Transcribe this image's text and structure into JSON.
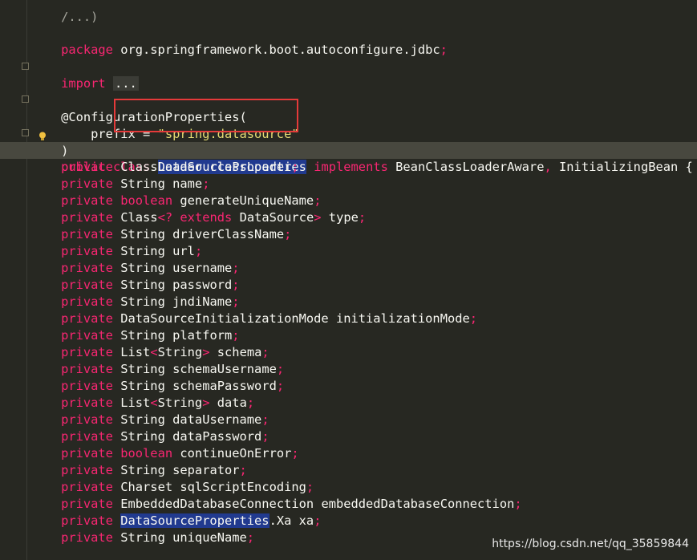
{
  "lines": {
    "top": "/...)",
    "package_kw": "package",
    "package_name": " org.springframework.boot.autoconfigure.jdbc",
    "package_end": ";",
    "import_kw": "import",
    "import_fold": "...",
    "annotation": "@ConfigurationProperties(",
    "prefix_name": "    prefix = ",
    "prefix_value": "\"spring.datasource\"",
    "close_paren": ")",
    "class_kw1": "public",
    "class_kw2": "class",
    "class_name": "DataSourceProperties",
    "implements_kw": "implements",
    "interfaces": " BeanClassLoaderAware",
    "interfaces_sep": ",",
    "interfaces2": " InitializingBean {"
  },
  "fields": [
    {
      "type": "ClassLoader",
      "name": "classLoader"
    },
    {
      "type": "String",
      "name": "name"
    },
    {
      "type_kw": "boolean",
      "name": "generateUniqueName"
    },
    {
      "type": "Class",
      "generic_open": "<?",
      "generic_kw": "extends",
      "generic_type": "DataSource",
      "generic_close": ">",
      "name": "type"
    },
    {
      "type": "String",
      "name": "driverClassName"
    },
    {
      "type": "String",
      "name": "url"
    },
    {
      "type": "String",
      "name": "username"
    },
    {
      "type": "String",
      "name": "password"
    },
    {
      "type": "String",
      "name": "jndiName"
    },
    {
      "type": "DataSourceInitializationMode",
      "name": "initializationMode"
    },
    {
      "type": "String",
      "name": "platform"
    },
    {
      "type": "List",
      "generic_open": "<",
      "generic_type": "String",
      "generic_close": ">",
      "name": "schema"
    },
    {
      "type": "String",
      "name": "schemaUsername"
    },
    {
      "type": "String",
      "name": "schemaPassword"
    },
    {
      "type": "List",
      "generic_open": "<",
      "generic_type": "String",
      "generic_close": ">",
      "name": "data"
    },
    {
      "type": "String",
      "name": "dataUsername"
    },
    {
      "type": "String",
      "name": "dataPassword"
    },
    {
      "type_kw": "boolean",
      "name": "continueOnError"
    },
    {
      "type": "String",
      "name": "separator"
    },
    {
      "type": "Charset",
      "name": "sqlScriptEncoding"
    },
    {
      "type": "EmbeddedDatabaseConnection",
      "name": "embeddedDatabaseConnection"
    },
    {
      "type_hl": "DataSourceProperties",
      "type": ".Xa",
      "name": "xa"
    },
    {
      "type": "String",
      "name": "uniqueName"
    }
  ],
  "private_kw": "private",
  "semicolon": ";",
  "watermark": "https://blog.csdn.net/qq_35859844",
  "colors": {
    "background": "#272822",
    "keyword": "#f92672",
    "string": "#e6db74",
    "selection": "#213a8f",
    "callout": "#e53a3a"
  }
}
